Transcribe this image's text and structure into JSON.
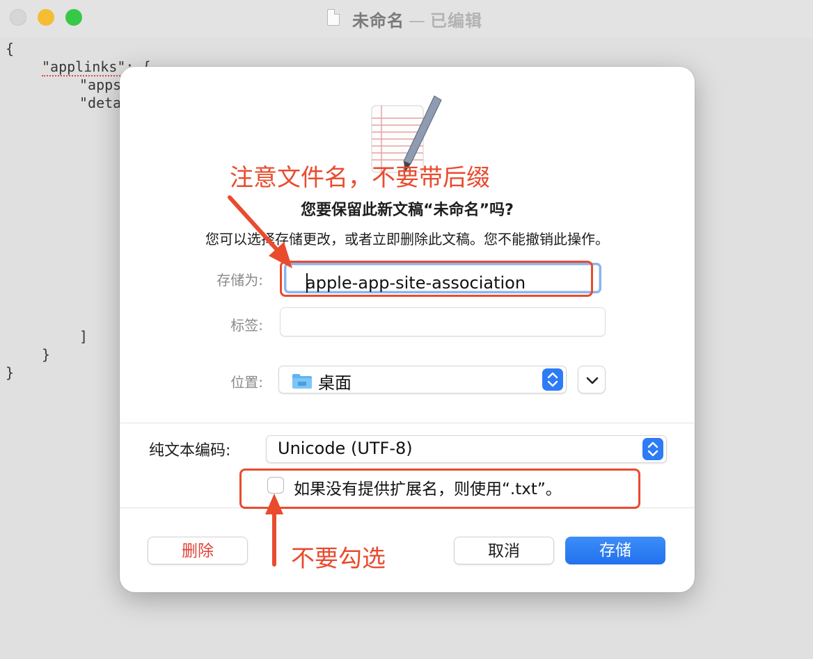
{
  "window": {
    "title": "未命名",
    "separator": "—",
    "status": "已编辑"
  },
  "editor": {
    "lines": [
      "{",
      "\"applinks\": {",
      "\"apps",
      "\"deta",
      "]",
      "}",
      "}"
    ]
  },
  "dialog": {
    "title": "您要保留此新文稿“未命名”吗?",
    "message": "您可以选择存储更改，或者立即删除此文稿。您不能撤销此操作。",
    "save_as_label": "存储为:",
    "save_as_value": "apple-app-site-association",
    "tags_label": "标签:",
    "tags_value": "",
    "location_label": "位置:",
    "location_value": "桌面",
    "encoding_label": "纯文本编码:",
    "encoding_value": "Unicode (UTF-8)",
    "checkbox_label": "如果没有提供扩展名，则使用“.txt”。",
    "checkbox_checked": false,
    "buttons": {
      "delete": "删除",
      "cancel": "取消",
      "save": "存储"
    }
  },
  "annotations": {
    "filename_note": "注意文件名，不要带后缀",
    "checkbox_note": "不要勾选",
    "color": "#e94b2e"
  },
  "colors": {
    "accent": "#2d7cf6",
    "delete": "#e0443a"
  }
}
